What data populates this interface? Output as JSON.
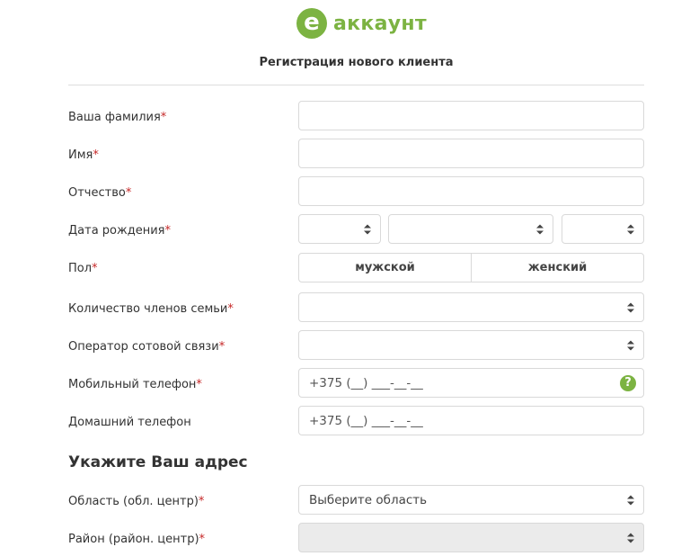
{
  "logo": {
    "mark": "e",
    "text": "аккаунт"
  },
  "page": {
    "title": "Регистрация нового клиента"
  },
  "form": {
    "required_mark": "*",
    "last_name": {
      "label": "Ваша фамилия",
      "value": ""
    },
    "first_name": {
      "label": "Имя",
      "value": ""
    },
    "patronymic": {
      "label": "Отчество",
      "value": ""
    },
    "birth_date": {
      "label": "Дата рождения",
      "day": "",
      "month": "",
      "year": ""
    },
    "gender": {
      "label": "Пол",
      "options": [
        "мужской",
        "женский"
      ]
    },
    "family_members": {
      "label": "Количество членов семьи",
      "value": ""
    },
    "mobile_operator": {
      "label": "Оператор сотовой связи",
      "value": ""
    },
    "mobile_phone": {
      "label": "Мобильный телефон",
      "placeholder": "+375 (__) ___-__-__",
      "help": "?"
    },
    "home_phone": {
      "label": "Домашний телефон",
      "placeholder": "+375 (__) ___-__-__"
    }
  },
  "address": {
    "title": "Укажите Ваш адрес",
    "region": {
      "label": "Область (обл. центр)",
      "value": "Выберите область"
    },
    "district": {
      "label": "Район (район. центр)",
      "value": "",
      "disabled": true
    }
  },
  "colors": {
    "brand": "#7cb342",
    "required": "#c62828",
    "disabled_bg": "#ebebeb"
  },
  "icons": {
    "logo": "logo-e-icon",
    "help": "help-icon",
    "select": "select-caret-icon"
  }
}
